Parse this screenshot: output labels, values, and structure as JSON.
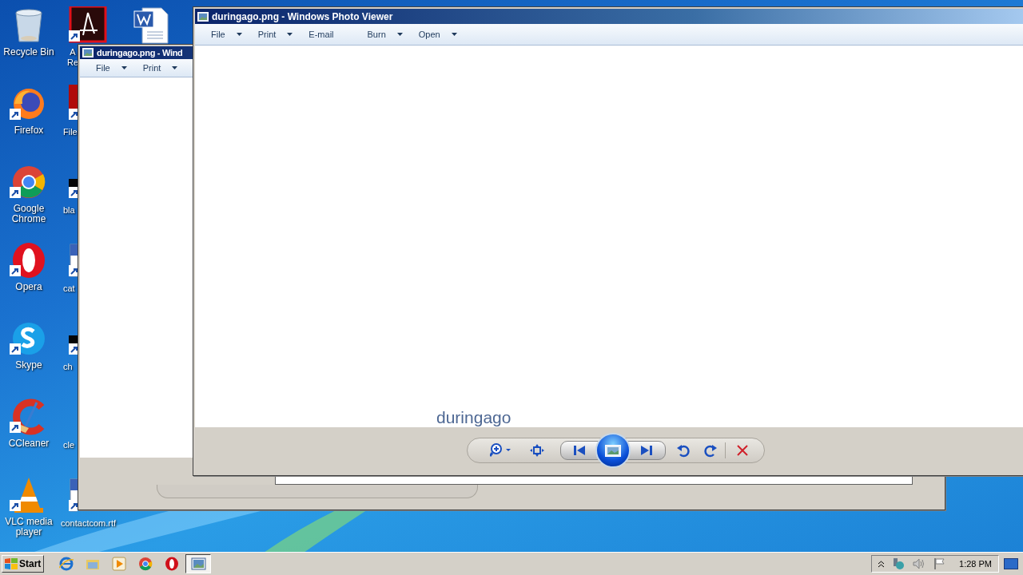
{
  "desktop_columns": [
    [
      {
        "label": "Recycle Bin",
        "kind": "bin"
      },
      {
        "label": "Firefox",
        "kind": "firefox"
      },
      {
        "label": "Google Chrome",
        "kind": "chrome"
      },
      {
        "label": "Opera",
        "kind": "opera"
      },
      {
        "label": "Skype",
        "kind": "skype"
      },
      {
        "label": "CCleaner",
        "kind": "ccleaner"
      },
      {
        "label": "VLC media player",
        "kind": "vlc"
      }
    ],
    [
      {
        "label": "A Re",
        "kind": "acrobat"
      },
      {
        "label": "File",
        "kind": "red"
      },
      {
        "label": "bla",
        "kind": "black"
      },
      {
        "label": "cat",
        "kind": "doc"
      },
      {
        "label": "ch",
        "kind": "black"
      },
      {
        "label": "cle",
        "kind": "blank"
      },
      {
        "label": "contactcom.rtf",
        "kind": "doc"
      }
    ],
    [
      {
        "kind": "word"
      }
    ]
  ],
  "back_window": {
    "title": "duringago.png - Wind",
    "menu": [
      {
        "label": "File",
        "dropdown": true
      },
      {
        "label": "Print",
        "dropdown": true
      }
    ]
  },
  "front_window": {
    "title": "duringago.png - Windows Photo Viewer",
    "menu": [
      {
        "label": "File",
        "dropdown": true
      },
      {
        "label": "Print",
        "dropdown": true
      },
      {
        "label": "E-mail",
        "dropdown": false
      },
      {
        "label": "Burn",
        "dropdown": true
      },
      {
        "label": "Open",
        "dropdown": true
      }
    ],
    "caption": "duringago"
  },
  "taskbar": {
    "start": "Start",
    "buttons": [
      {
        "kind": "ie",
        "selected": false
      },
      {
        "kind": "folder",
        "selected": false
      },
      {
        "kind": "media",
        "selected": false
      },
      {
        "kind": "chrome",
        "selected": false
      },
      {
        "kind": "opera",
        "selected": false
      },
      {
        "kind": "photo",
        "selected": true
      }
    ],
    "clock": "1:28 PM"
  }
}
